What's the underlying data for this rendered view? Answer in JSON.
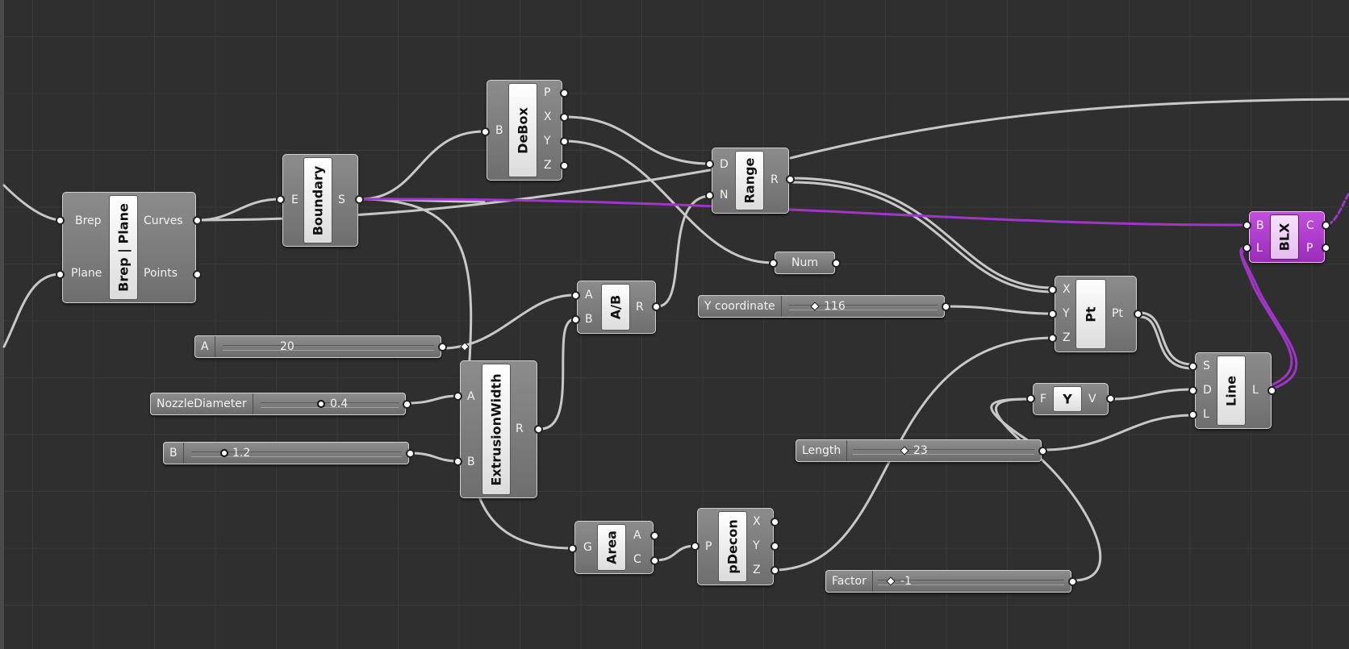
{
  "components": {
    "brep_plane": {
      "core": "Brep | Plane",
      "inputs": [
        "Brep",
        "Plane"
      ],
      "outputs": [
        "Curves",
        "Points"
      ]
    },
    "boundary": {
      "core": "Boundary",
      "inputs": [
        "E"
      ],
      "outputs": [
        "S"
      ]
    },
    "debox": {
      "core": "DeBox",
      "inputs": [
        "B"
      ],
      "outputs": [
        "P",
        "X",
        "Y",
        "Z"
      ]
    },
    "range": {
      "core": "Range",
      "inputs": [
        "D",
        "N"
      ],
      "outputs": [
        "R"
      ]
    },
    "num": {
      "label": "Num"
    },
    "division": {
      "core": "A/B",
      "inputs": [
        "A",
        "B"
      ],
      "outputs": [
        "R"
      ]
    },
    "extrusion_width": {
      "core": "ExtrusionWidth",
      "inputs": [
        "A",
        "B"
      ],
      "outputs": [
        "R"
      ]
    },
    "area": {
      "core": "Area",
      "inputs": [
        "G"
      ],
      "outputs": [
        "A",
        "C"
      ]
    },
    "pdecon": {
      "core": "pDecon",
      "inputs": [
        "P"
      ],
      "outputs": [
        "X",
        "Y",
        "Z"
      ]
    },
    "point": {
      "core": "Pt",
      "inputs": [
        "X",
        "Y",
        "Z"
      ],
      "outputs": [
        "Pt"
      ]
    },
    "unit_y": {
      "core": "Y",
      "inputs": [
        "F"
      ],
      "outputs": [
        "V"
      ]
    },
    "line": {
      "core": "Line",
      "inputs": [
        "S",
        "D",
        "L"
      ],
      "outputs": [
        "L"
      ]
    },
    "blx": {
      "core": "BLX",
      "inputs": [
        "B",
        "L"
      ],
      "outputs": [
        "C",
        "P"
      ]
    }
  },
  "sliders": {
    "a": {
      "label": "A",
      "value": "20"
    },
    "nozzle": {
      "label": "NozzleDiameter",
      "value": "0.4"
    },
    "b": {
      "label": "B",
      "value": "1.2"
    },
    "ycoord": {
      "label": "Y coordinate",
      "value": "116"
    },
    "length": {
      "label": "Length",
      "value": "23"
    },
    "factor": {
      "label": "Factor",
      "value": "-1"
    }
  },
  "colors": {
    "canvas": "#2f2f2f",
    "wire": "#c8c8c8",
    "selected_wire": "#a035c8",
    "component": "#7d7d7d",
    "selected_component": "#b040d0"
  }
}
